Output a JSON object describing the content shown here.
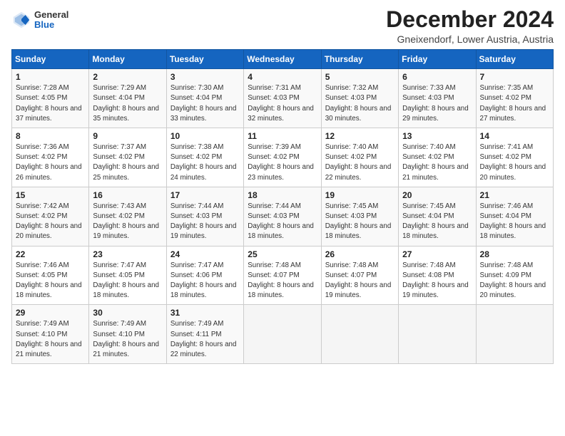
{
  "header": {
    "logo": {
      "general": "General",
      "blue": "Blue"
    },
    "title": "December 2024",
    "location": "Gneixendorf, Lower Austria, Austria"
  },
  "weekdays": [
    "Sunday",
    "Monday",
    "Tuesday",
    "Wednesday",
    "Thursday",
    "Friday",
    "Saturday"
  ],
  "weeks": [
    [
      {
        "day": "1",
        "sunrise": "Sunrise: 7:28 AM",
        "sunset": "Sunset: 4:05 PM",
        "daylight": "Daylight: 8 hours and 37 minutes."
      },
      {
        "day": "2",
        "sunrise": "Sunrise: 7:29 AM",
        "sunset": "Sunset: 4:04 PM",
        "daylight": "Daylight: 8 hours and 35 minutes."
      },
      {
        "day": "3",
        "sunrise": "Sunrise: 7:30 AM",
        "sunset": "Sunset: 4:04 PM",
        "daylight": "Daylight: 8 hours and 33 minutes."
      },
      {
        "day": "4",
        "sunrise": "Sunrise: 7:31 AM",
        "sunset": "Sunset: 4:03 PM",
        "daylight": "Daylight: 8 hours and 32 minutes."
      },
      {
        "day": "5",
        "sunrise": "Sunrise: 7:32 AM",
        "sunset": "Sunset: 4:03 PM",
        "daylight": "Daylight: 8 hours and 30 minutes."
      },
      {
        "day": "6",
        "sunrise": "Sunrise: 7:33 AM",
        "sunset": "Sunset: 4:03 PM",
        "daylight": "Daylight: 8 hours and 29 minutes."
      },
      {
        "day": "7",
        "sunrise": "Sunrise: 7:35 AM",
        "sunset": "Sunset: 4:02 PM",
        "daylight": "Daylight: 8 hours and 27 minutes."
      }
    ],
    [
      {
        "day": "8",
        "sunrise": "Sunrise: 7:36 AM",
        "sunset": "Sunset: 4:02 PM",
        "daylight": "Daylight: 8 hours and 26 minutes."
      },
      {
        "day": "9",
        "sunrise": "Sunrise: 7:37 AM",
        "sunset": "Sunset: 4:02 PM",
        "daylight": "Daylight: 8 hours and 25 minutes."
      },
      {
        "day": "10",
        "sunrise": "Sunrise: 7:38 AM",
        "sunset": "Sunset: 4:02 PM",
        "daylight": "Daylight: 8 hours and 24 minutes."
      },
      {
        "day": "11",
        "sunrise": "Sunrise: 7:39 AM",
        "sunset": "Sunset: 4:02 PM",
        "daylight": "Daylight: 8 hours and 23 minutes."
      },
      {
        "day": "12",
        "sunrise": "Sunrise: 7:40 AM",
        "sunset": "Sunset: 4:02 PM",
        "daylight": "Daylight: 8 hours and 22 minutes."
      },
      {
        "day": "13",
        "sunrise": "Sunrise: 7:40 AM",
        "sunset": "Sunset: 4:02 PM",
        "daylight": "Daylight: 8 hours and 21 minutes."
      },
      {
        "day": "14",
        "sunrise": "Sunrise: 7:41 AM",
        "sunset": "Sunset: 4:02 PM",
        "daylight": "Daylight: 8 hours and 20 minutes."
      }
    ],
    [
      {
        "day": "15",
        "sunrise": "Sunrise: 7:42 AM",
        "sunset": "Sunset: 4:02 PM",
        "daylight": "Daylight: 8 hours and 20 minutes."
      },
      {
        "day": "16",
        "sunrise": "Sunrise: 7:43 AM",
        "sunset": "Sunset: 4:02 PM",
        "daylight": "Daylight: 8 hours and 19 minutes."
      },
      {
        "day": "17",
        "sunrise": "Sunrise: 7:44 AM",
        "sunset": "Sunset: 4:03 PM",
        "daylight": "Daylight: 8 hours and 19 minutes."
      },
      {
        "day": "18",
        "sunrise": "Sunrise: 7:44 AM",
        "sunset": "Sunset: 4:03 PM",
        "daylight": "Daylight: 8 hours and 18 minutes."
      },
      {
        "day": "19",
        "sunrise": "Sunrise: 7:45 AM",
        "sunset": "Sunset: 4:03 PM",
        "daylight": "Daylight: 8 hours and 18 minutes."
      },
      {
        "day": "20",
        "sunrise": "Sunrise: 7:45 AM",
        "sunset": "Sunset: 4:04 PM",
        "daylight": "Daylight: 8 hours and 18 minutes."
      },
      {
        "day": "21",
        "sunrise": "Sunrise: 7:46 AM",
        "sunset": "Sunset: 4:04 PM",
        "daylight": "Daylight: 8 hours and 18 minutes."
      }
    ],
    [
      {
        "day": "22",
        "sunrise": "Sunrise: 7:46 AM",
        "sunset": "Sunset: 4:05 PM",
        "daylight": "Daylight: 8 hours and 18 minutes."
      },
      {
        "day": "23",
        "sunrise": "Sunrise: 7:47 AM",
        "sunset": "Sunset: 4:05 PM",
        "daylight": "Daylight: 8 hours and 18 minutes."
      },
      {
        "day": "24",
        "sunrise": "Sunrise: 7:47 AM",
        "sunset": "Sunset: 4:06 PM",
        "daylight": "Daylight: 8 hours and 18 minutes."
      },
      {
        "day": "25",
        "sunrise": "Sunrise: 7:48 AM",
        "sunset": "Sunset: 4:07 PM",
        "daylight": "Daylight: 8 hours and 18 minutes."
      },
      {
        "day": "26",
        "sunrise": "Sunrise: 7:48 AM",
        "sunset": "Sunset: 4:07 PM",
        "daylight": "Daylight: 8 hours and 19 minutes."
      },
      {
        "day": "27",
        "sunrise": "Sunrise: 7:48 AM",
        "sunset": "Sunset: 4:08 PM",
        "daylight": "Daylight: 8 hours and 19 minutes."
      },
      {
        "day": "28",
        "sunrise": "Sunrise: 7:48 AM",
        "sunset": "Sunset: 4:09 PM",
        "daylight": "Daylight: 8 hours and 20 minutes."
      }
    ],
    [
      {
        "day": "29",
        "sunrise": "Sunrise: 7:49 AM",
        "sunset": "Sunset: 4:10 PM",
        "daylight": "Daylight: 8 hours and 21 minutes."
      },
      {
        "day": "30",
        "sunrise": "Sunrise: 7:49 AM",
        "sunset": "Sunset: 4:10 PM",
        "daylight": "Daylight: 8 hours and 21 minutes."
      },
      {
        "day": "31",
        "sunrise": "Sunrise: 7:49 AM",
        "sunset": "Sunset: 4:11 PM",
        "daylight": "Daylight: 8 hours and 22 minutes."
      },
      null,
      null,
      null,
      null
    ]
  ]
}
